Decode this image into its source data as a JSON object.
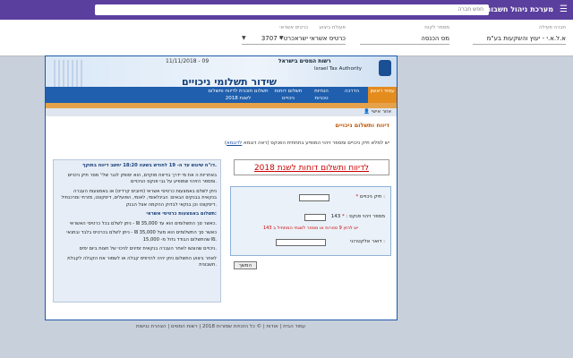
{
  "topbar": {
    "brand": "מערכת ניהול חשבונות",
    "search_placeholder": "חפש חברה",
    "menu_icon": "hamburger-icon"
  },
  "filters": [
    {
      "label": "חברה פעילה",
      "value": "א.ל.א.י - יעוץ והשקעות בע\"מ"
    },
    {
      "label": "מספר לקוח",
      "value": "מס הכנסה"
    },
    {
      "label": "פעולת ביצוע",
      "value": "כרטיס אשראי"
    },
    {
      "label": "כרטיס אשראי",
      "value": "ישראכרט - 3707"
    },
    {
      "label": "",
      "value": ""
    }
  ],
  "banner": {
    "date": "11/11/2018 - 09",
    "authority_he": "רשות המסים בישראל",
    "authority_sub": "משרד האוצר",
    "authority_en": "Israel Tax Authority",
    "title": "שידור תשלומי ניכויים"
  },
  "nav": {
    "tabs": [
      {
        "label": "עמוד ראשון",
        "active": true
      },
      {
        "label": "הדרכה",
        "active": false
      },
      {
        "label": "הנחיות טכניות",
        "active": false
      },
      {
        "label": "תשלום דוחות ניכויים",
        "active": false
      },
      {
        "label": "תשלום תוכנית לדיווח ותשלום לשנת 2018",
        "active": false
      }
    ]
  },
  "userbar": {
    "user": "אזור אישי"
  },
  "content": {
    "section_title": "דיווח ותשלום ניכויים",
    "intro": "יש למלא תיק ניכויים ומספר זיהוי המופיע בתחתית הפנקס (ראה דוגמא",
    "intro_link": "לדוגמא",
    "red_link": "לדיווח ותשלום דוחות לשנת 2018",
    "form": {
      "file_label": "תיק ניכויים :",
      "id_label": "מספר זיהוי פנקס :",
      "id_prefix": "143",
      "error": "יש להזין 9 ספרות או מספר לשנתי המתחיל ב 143",
      "email_label": "דואר אלקטרוני :"
    },
    "submit_label": "המשך",
    "side": [
      {
        "heading": true,
        "text": "דו\"ח שיוגש עד ה- 19 לחודש בשעה 18:20 יחשב דיווח בתוקף."
      },
      {
        "heading": false,
        "text": "באחריות ה את מי ידרך בדיווח מוקדם, הוא יסופק לנגר שלי' מסר תיק ניכויים ומספר הזיהוי שמופיע על גבי פנקס הניכויים."
      },
      {
        "heading": false,
        "text": "ניתן לשלם באמצעות כרטיסי אשראי (חיובים קרדיט) או באמצעות העברה בנקאית בבנקים הבאים: הבינלאומי, לאומי, הפועלים, דיסקונט, מזרחי ומרכנתיל דיסקונט וכן בנקאי לבדוק ההקמה אצל הבנק."
      },
      {
        "heading": true,
        "text": "תשלום באמצעות כרטיסי אשראי:"
      },
      {
        "heading": false,
        "text": "כאשר סך התשלומים הוא עד 35,000 ₪ - ניתן לשלם בכל כרטיסי האשראי."
      },
      {
        "heading": false,
        "text": "כאשר סך התשלומים הוא מעל 35,000 ₪ - ניתן לשלם בכרטיס בלבד ובתנאי שהתשלום הבודד גדול מ- 15,000 ₪."
      },
      {
        "heading": false,
        "text": "ניכויים שהוגשו לאחר העברה בנקאית זמינים לניכוי של חצות ביום ימים."
      },
      {
        "heading": false,
        "text": "לאחר ביצוע התשלום ניתן יהיה להדפיס קבלה או לשמור את הקבלה לקבלת חשבונית."
      }
    ]
  },
  "footer": "עמוד הבית | אודות | © כל הזכויות שמורות 2018 | רשות המסים | הצהרת נגישות"
}
